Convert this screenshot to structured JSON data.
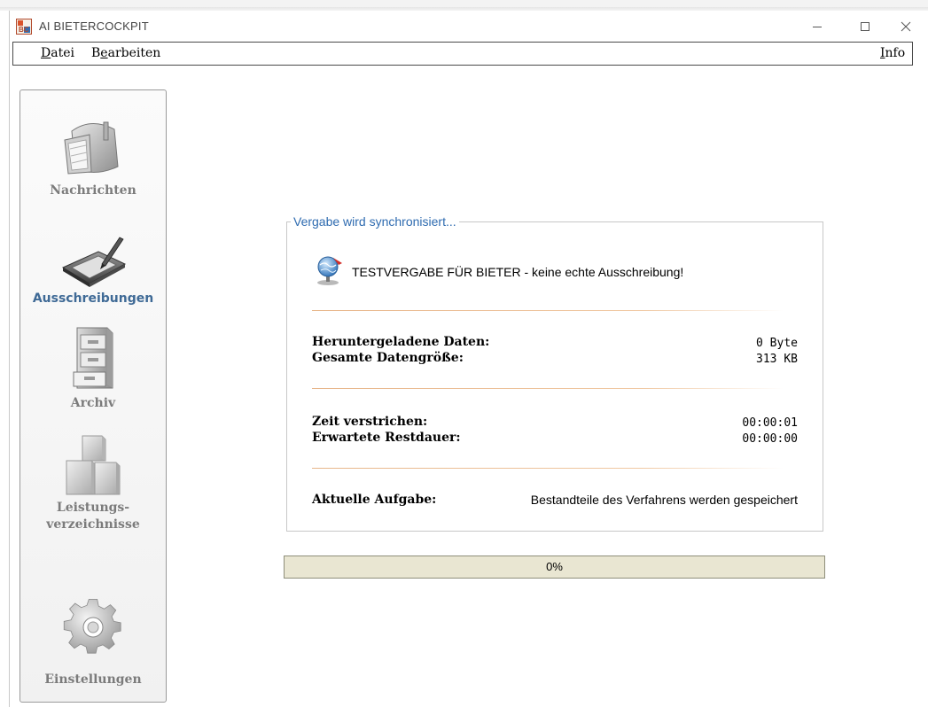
{
  "window": {
    "title": "AI BIETERCOCKPIT"
  },
  "menu": {
    "datei": {
      "mnemonic": "D",
      "rest": "atei"
    },
    "bearbeiten": {
      "first": "B",
      "mnemonic": "e",
      "rest": "arbeiten"
    },
    "info": {
      "mnemonic": "I",
      "rest": "nfo"
    }
  },
  "sidebar": {
    "items": [
      {
        "label": "Nachrichten",
        "icon": "mailbox-icon",
        "active": false
      },
      {
        "label": "Ausschreibungen",
        "icon": "signature-pad-icon",
        "active": true
      },
      {
        "label": "Archiv",
        "icon": "file-cabinet-icon",
        "active": false
      },
      {
        "label_line1": "Leistungs-",
        "label_line2": "verzeichnisse",
        "icon": "blocks-icon",
        "active": false
      },
      {
        "label": "Einstellungen",
        "icon": "gear-icon",
        "active": false
      }
    ]
  },
  "sync": {
    "legend": "Vergabe wird synchronisiert...",
    "vergabe_title": "TESTVERGABE FÜR BIETER - keine echte Ausschreibung!",
    "downloaded_label": "Heruntergeladene Daten:",
    "downloaded_value": "0 Byte",
    "total_label": "Gesamte Datengröße:",
    "total_value": "313 KB",
    "elapsed_label": "Zeit verstrichen:",
    "elapsed_value": "00:00:01",
    "remaining_label": "Erwartete Restdauer:",
    "remaining_value": "00:00:00",
    "task_label": "Aktuelle Aufgabe:",
    "task_value": "Bestandteile des Verfahrens werden gespeichert"
  },
  "progress": {
    "value": 0,
    "text": "0%"
  },
  "colors": {
    "legend": "#2e6bb0",
    "active_nav": "#3f6a96",
    "inactive_nav": "#7b7b7b",
    "separator": "#e7b68a",
    "progress_track": "#e9e6d2"
  }
}
